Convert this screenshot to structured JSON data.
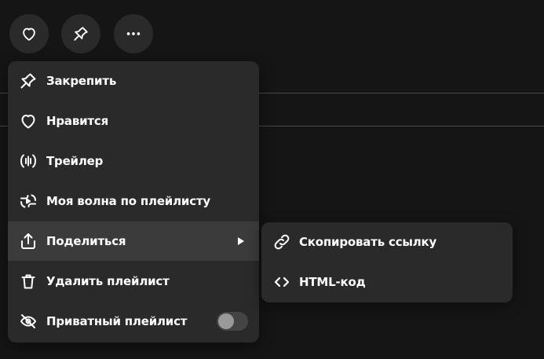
{
  "header": {
    "like_icon": "heart-icon",
    "pin_icon": "pin-icon",
    "more_icon": "more-dots-icon"
  },
  "menu": {
    "items": [
      {
        "label": "Закрепить",
        "icon": "pin-icon"
      },
      {
        "label": "Нравится",
        "icon": "heart-icon"
      },
      {
        "label": "Трейлер",
        "icon": "trailer-icon"
      },
      {
        "label": "Моя волна по плейлисту",
        "icon": "wave-icon"
      },
      {
        "label": "Поделиться",
        "icon": "share-icon"
      },
      {
        "label": "Удалить плейлист",
        "icon": "trash-icon"
      },
      {
        "label": "Приватный плейлист",
        "icon": "eye-off-icon"
      }
    ],
    "private_toggle_on": false
  },
  "submenu": {
    "items": [
      {
        "label": "Скопировать ссылку",
        "icon": "link-icon"
      },
      {
        "label": "HTML-код",
        "icon": "code-icon"
      }
    ]
  },
  "colors": {
    "background": "#151515",
    "menu_bg": "#2a2a2a",
    "active_bg": "#3b3b3b",
    "text": "#ffffff"
  }
}
